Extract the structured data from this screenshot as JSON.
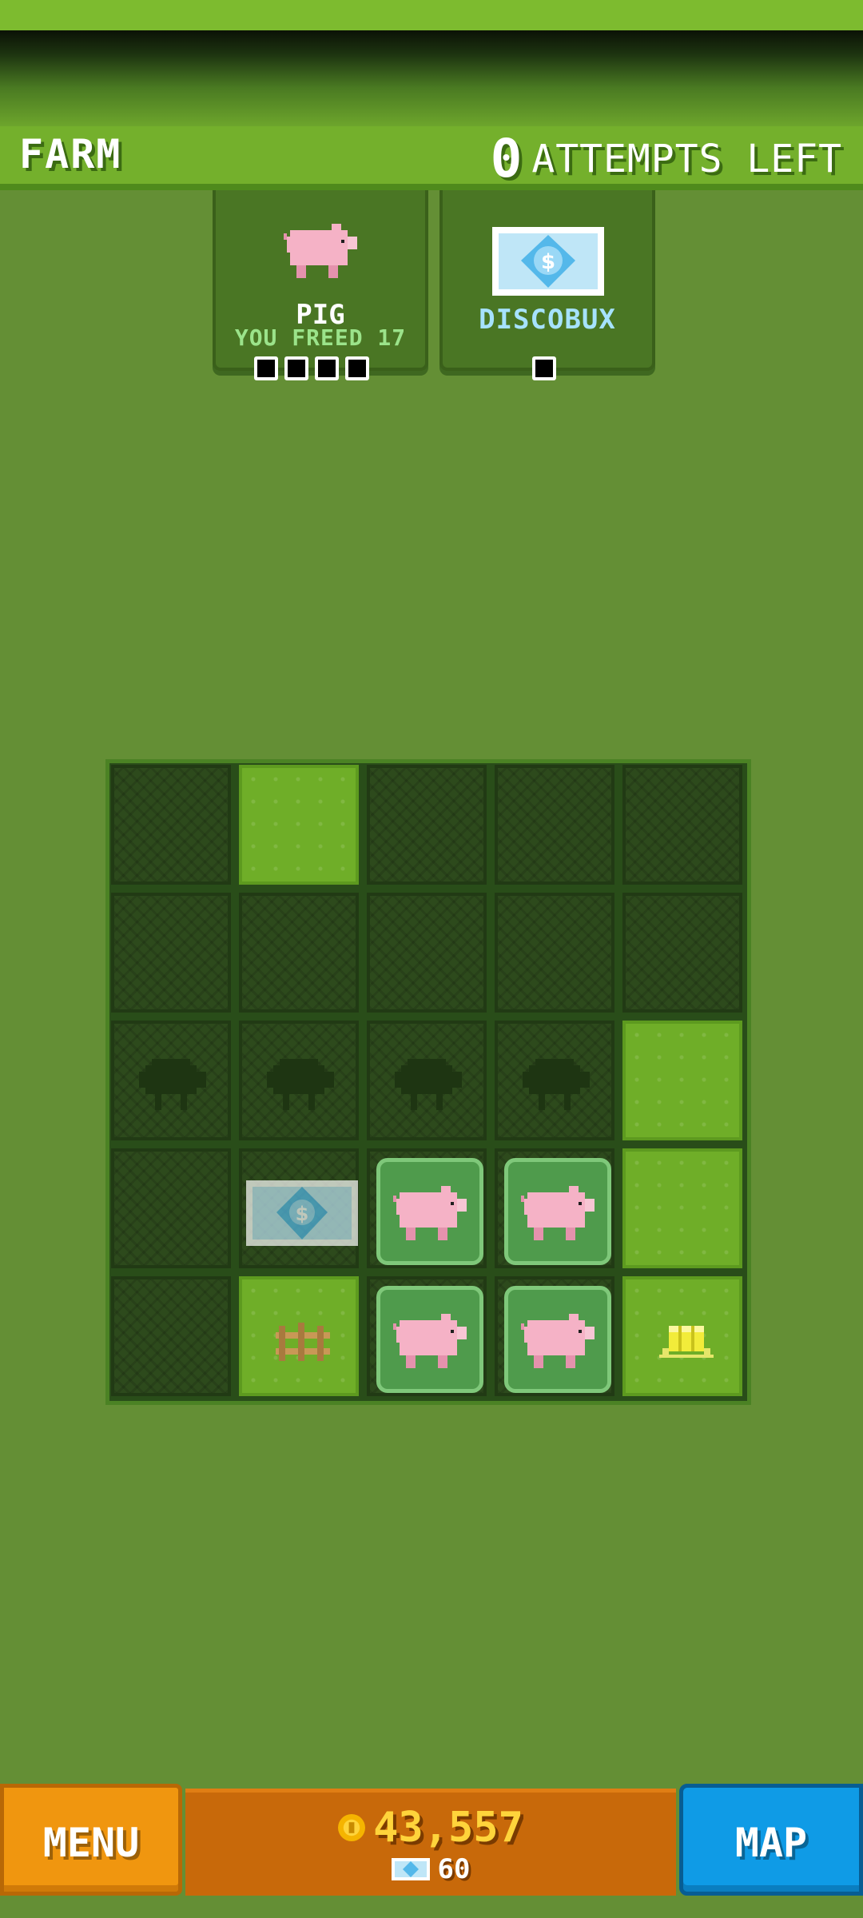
{
  "header": {
    "title": "FARM",
    "attempts_count": "0",
    "attempts_label": "ATTEMPTS LEFT"
  },
  "goals": [
    {
      "icon": "pig-icon",
      "name": "PIG",
      "subtitle": "YOU FREED 17",
      "pips": 4
    },
    {
      "icon": "discobux-icon",
      "name": "DISCOBUX",
      "pips": 1
    }
  ],
  "grid": {
    "rows": 5,
    "cols": 5,
    "cells": [
      [
        "dark",
        "light",
        "dark",
        "dark",
        "dark"
      ],
      [
        "dark",
        "dark",
        "dark",
        "dark",
        "dark"
      ],
      [
        "sheep-silhouette",
        "sheep-silhouette",
        "sheep-silhouette",
        "sheep-silhouette",
        "light"
      ],
      [
        "dark",
        "discobux",
        "pig",
        "pig",
        "light"
      ],
      [
        "dark",
        "light-fence",
        "pig",
        "pig",
        "light-hay"
      ]
    ]
  },
  "footer": {
    "menu_label": "MENU",
    "map_label": "MAP",
    "coins": "43,557",
    "discobux": "60"
  },
  "colors": {
    "background": "#648f35",
    "header": "#74b02c",
    "menu": "#f0960f",
    "map": "#0f9be6",
    "coins_text": "#ffd43b",
    "freed_text": "#9be38a",
    "discobux_text": "#a6e2ff"
  }
}
